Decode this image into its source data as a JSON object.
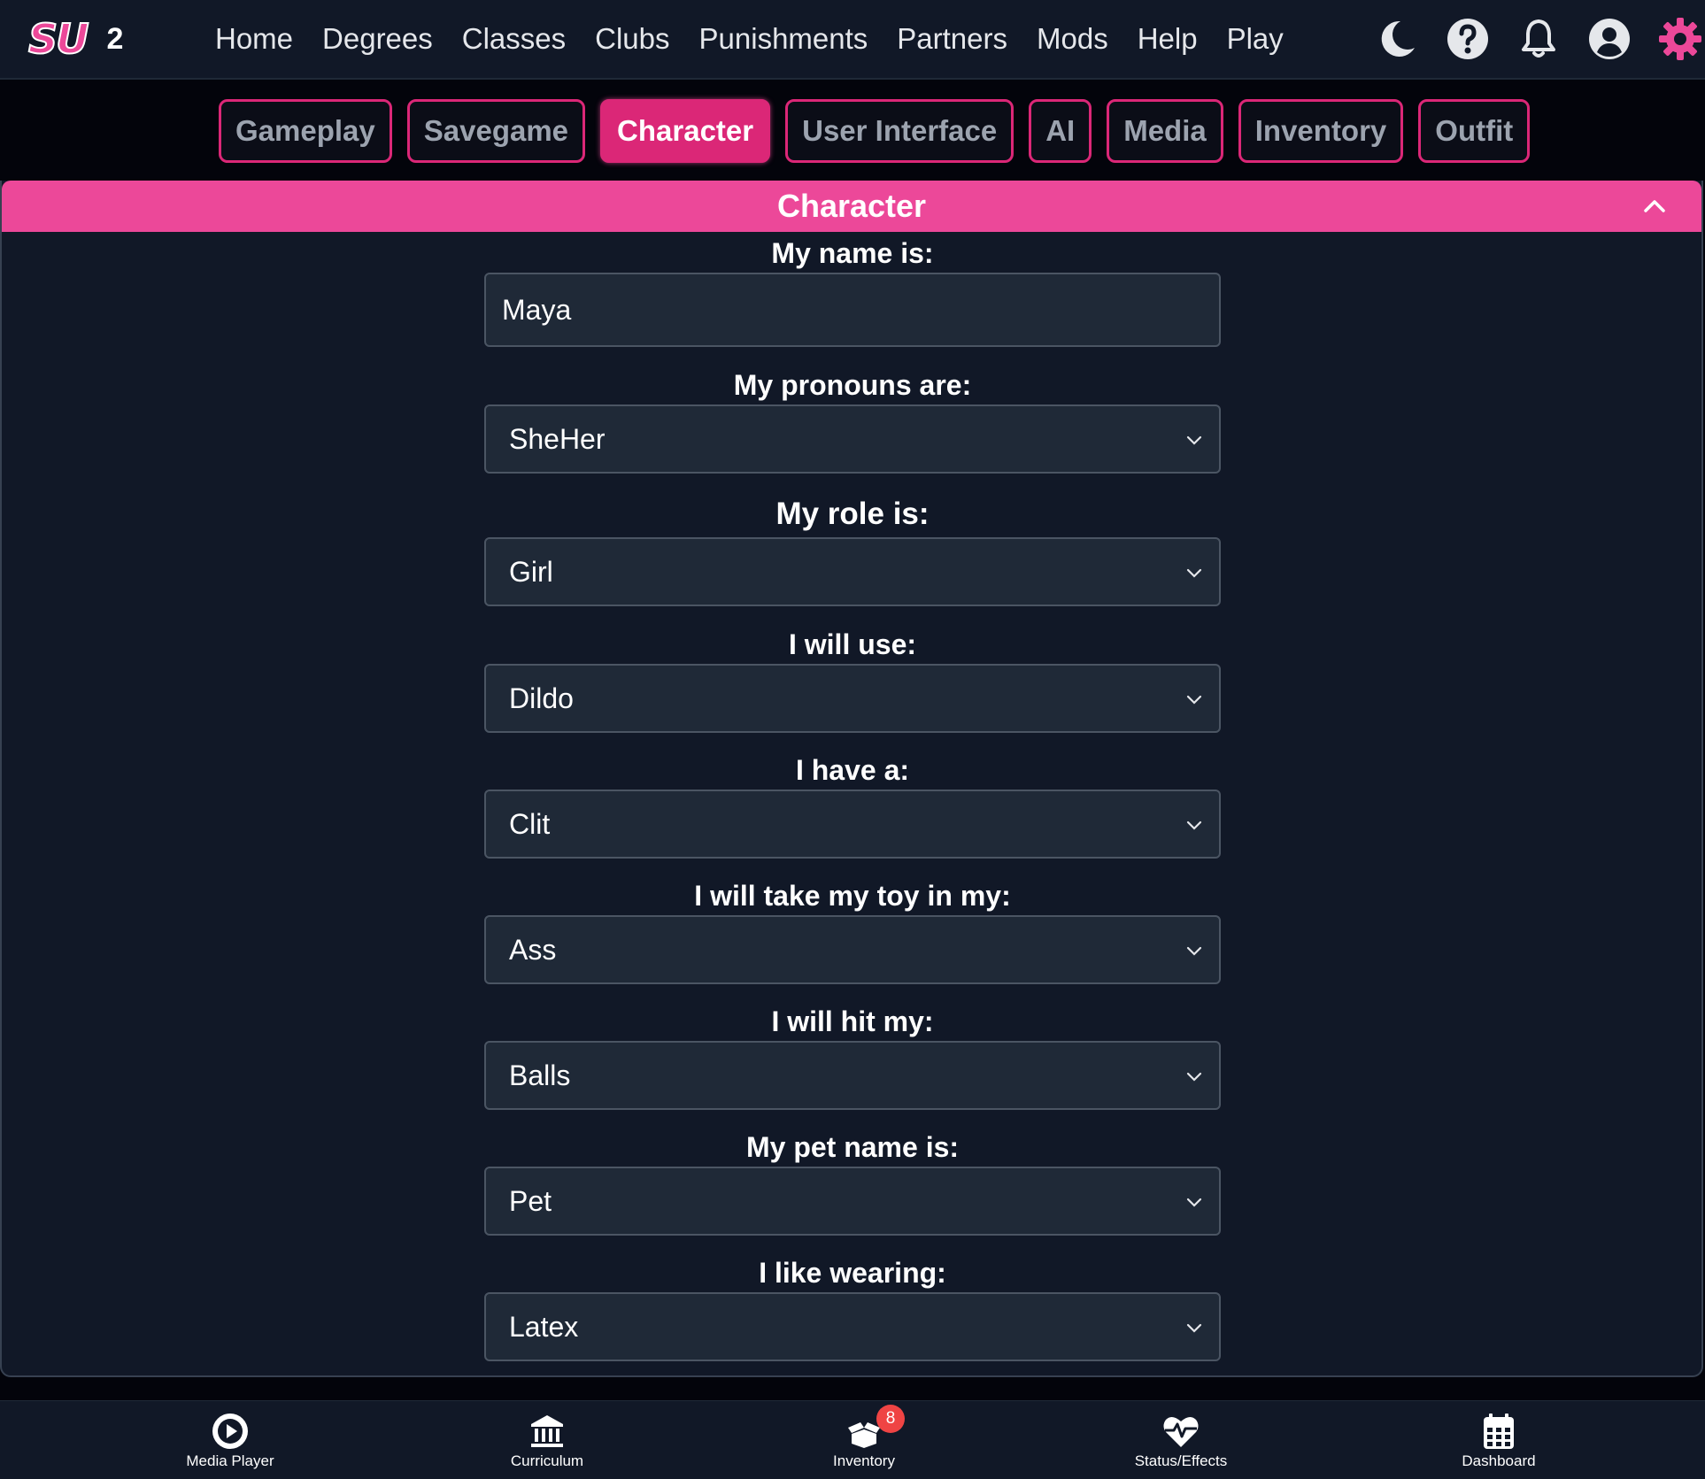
{
  "brand": {
    "logo": "SU",
    "version": "2"
  },
  "nav": {
    "links": [
      "Home",
      "Degrees",
      "Classes",
      "Clubs",
      "Punishments",
      "Partners",
      "Mods",
      "Help",
      "Play"
    ],
    "icons": [
      "moon-icon",
      "question-circle-icon",
      "bell-icon",
      "user-circle-icon",
      "gear-icon"
    ]
  },
  "tabs": [
    {
      "label": "Gameplay",
      "active": false
    },
    {
      "label": "Savegame",
      "active": false
    },
    {
      "label": "Character",
      "active": true
    },
    {
      "label": "User Interface",
      "active": false
    },
    {
      "label": "AI",
      "active": false
    },
    {
      "label": "Media",
      "active": false
    },
    {
      "label": "Inventory",
      "active": false
    },
    {
      "label": "Outfit",
      "active": false
    }
  ],
  "panel": {
    "title": "Character",
    "fields": [
      {
        "label": "My name is:",
        "type": "input",
        "value": "Maya"
      },
      {
        "label": "My pronouns are:",
        "type": "select",
        "value": "SheHer"
      },
      {
        "label": "My role is:",
        "type": "select",
        "value": "Girl"
      },
      {
        "label": "I will use:",
        "type": "select",
        "value": "Dildo"
      },
      {
        "label": "I have a:",
        "type": "select",
        "value": "Clit"
      },
      {
        "label": "I will take my toy in my:",
        "type": "select",
        "value": "Ass"
      },
      {
        "label": "I will hit my:",
        "type": "select",
        "value": "Balls"
      },
      {
        "label": "My pet name is:",
        "type": "select",
        "value": "Pet"
      },
      {
        "label": "I like wearing:",
        "type": "select",
        "value": "Latex"
      }
    ]
  },
  "bottombar": {
    "items": [
      {
        "label": "Media Player",
        "icon": "play-circle-icon"
      },
      {
        "label": "Curriculum",
        "icon": "institution-icon"
      },
      {
        "label": "Inventory",
        "icon": "box-open-icon",
        "badge": "8"
      },
      {
        "label": "Status/Effects",
        "icon": "heart-pulse-icon"
      },
      {
        "label": "Dashboard",
        "icon": "calendar-icon"
      }
    ]
  },
  "colors": {
    "accent": "#ec4899",
    "accent_dark": "#db2777",
    "panel_bg": "#111827",
    "control_bg": "#1f2937",
    "badge": "#ef4444"
  }
}
